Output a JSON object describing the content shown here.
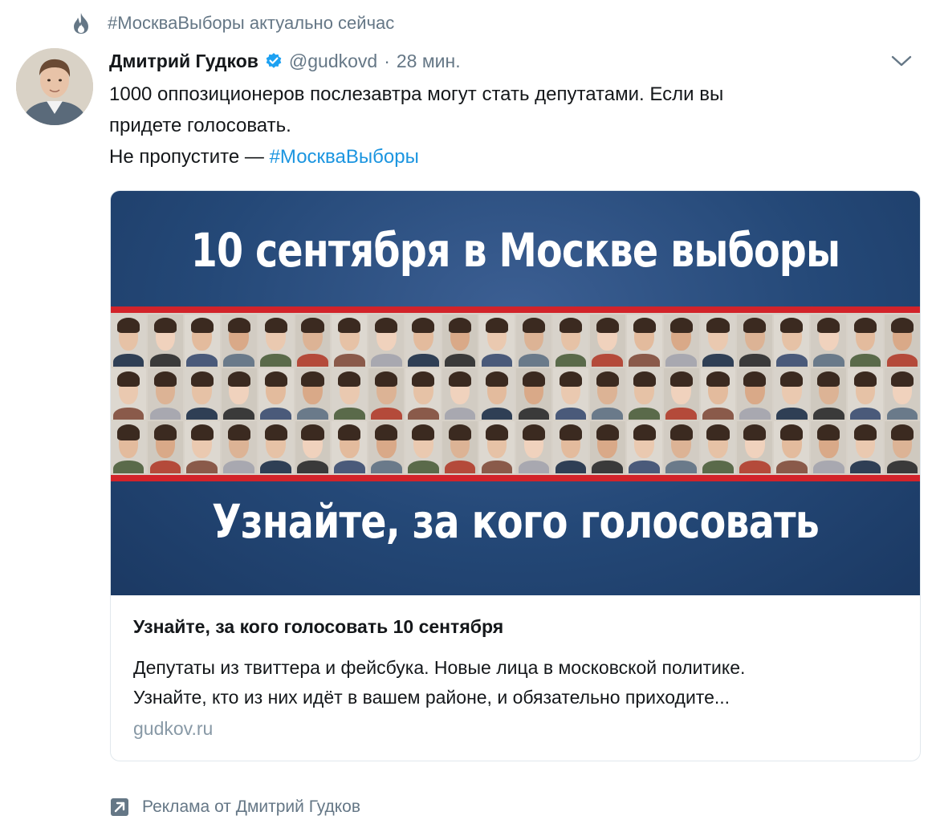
{
  "trend": {
    "icon": "flame-icon",
    "text": "#МоскваВыборы актуально сейчас"
  },
  "tweet": {
    "author_name": "Дмитрий Гудков",
    "verified": true,
    "handle": "@gudkovd",
    "separator": "·",
    "time": "28 мин.",
    "text_line1": "1000 оппозиционеров послезавтра могут стать депутатами. Если вы",
    "text_line2": "придете голосовать.",
    "text_line3_prefix": "Не пропустите — ",
    "hashtag": "#МоскваВыборы"
  },
  "card": {
    "image_title": "10 сентября в Москве выборы",
    "image_subtitle": "Узнайте, за кого голосовать",
    "title": "Узнайте, за кого голосовать 10 сентября",
    "description_line1": "Депутаты из твиттера и фейсбука. Новые лица в московской политике.",
    "description_line2": "Узнайте, кто из них идёт в вашем районе, и обязательно приходите...",
    "domain": "gudkov.ru"
  },
  "promoted": {
    "icon": "promoted-arrow-icon",
    "text": "Реклама от Дмитрий Гудков"
  },
  "colors": {
    "link": "#1b95e0",
    "secondary_text": "#657786",
    "verified_badge": "#1da1f2",
    "banner_blue": "#244877",
    "banner_red": "#d2232a"
  }
}
